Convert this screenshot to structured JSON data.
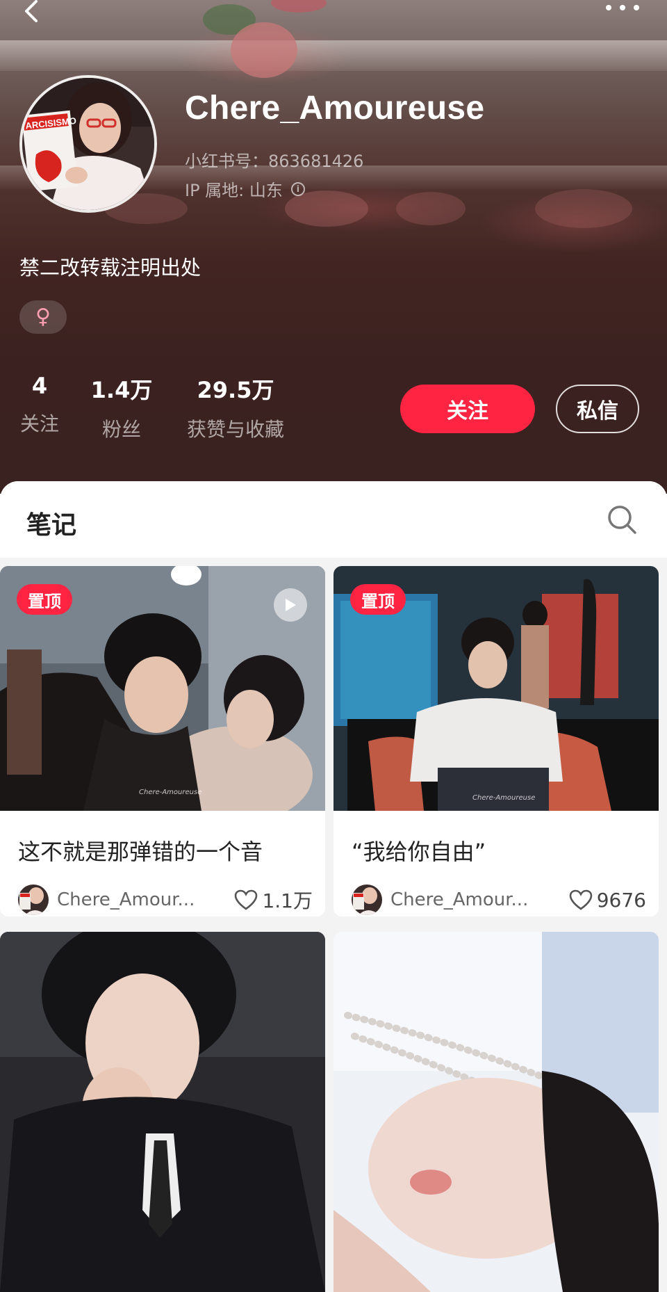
{
  "nav": {
    "back_icon": "chevron-left-icon",
    "more_icon": "more-dots-icon"
  },
  "profile": {
    "username": "Chere_Amoureuse",
    "red_id": "小红书号：863681426",
    "ip_location": "IP 属地: 山东",
    "bio": "禁二改转载注明出处",
    "gender_symbol": "♀"
  },
  "stats": [
    {
      "value": "4",
      "label": "关注"
    },
    {
      "value": "1.4万",
      "label": "粉丝"
    },
    {
      "value": "29.5万",
      "label": "获赞与收藏"
    }
  ],
  "actions": {
    "follow_label": "关注",
    "message_label": "私信"
  },
  "colors": {
    "accent": "#ff2442",
    "header_bg": "#3b2220"
  },
  "tabs": {
    "notes_label": "笔记",
    "search_icon": "search-icon"
  },
  "notes": [
    {
      "pinned_label": "置顶",
      "is_video": true,
      "title": "这不就是那弹错的一个音",
      "author": "Chere_Amour...",
      "likes": "1.1万",
      "watermark": "Chere-Amoureuse"
    },
    {
      "pinned_label": "置顶",
      "is_video": false,
      "title": "“我给你自由”",
      "author": "Chere_Amour...",
      "likes": "9676",
      "watermark": "Chere-Amoureuse"
    },
    {
      "pinned_label": "",
      "is_video": false,
      "title": "",
      "author": "",
      "likes": ""
    },
    {
      "pinned_label": "",
      "is_video": false,
      "title": "",
      "author": "",
      "likes": ""
    }
  ]
}
